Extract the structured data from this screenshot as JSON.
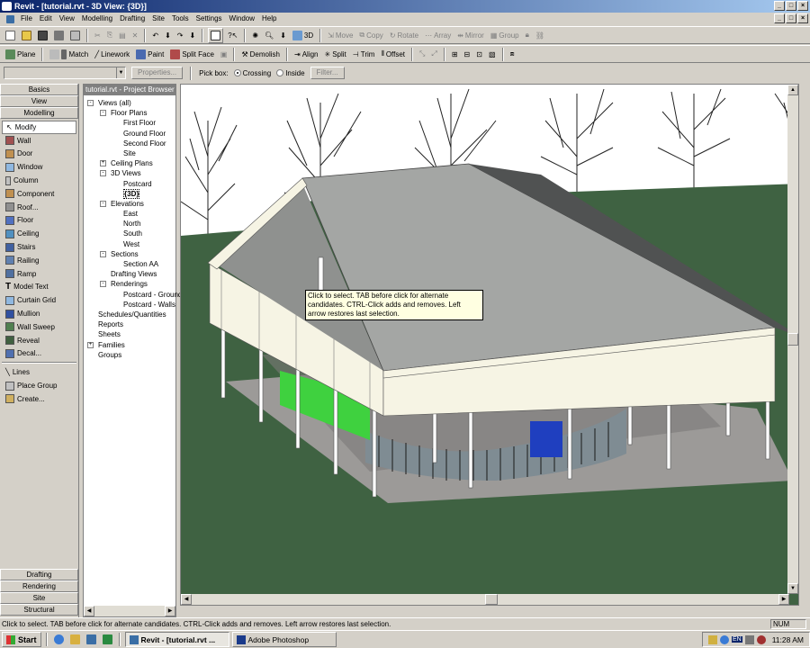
{
  "window": {
    "title": "Revit - [tutorial.rvt - 3D View: {3D}]"
  },
  "menu": [
    "File",
    "Edit",
    "View",
    "Modelling",
    "Drafting",
    "Site",
    "Tools",
    "Settings",
    "Window",
    "Help"
  ],
  "toolbar1": {
    "view3d_label": "3D",
    "edit_tools": [
      "Move",
      "Copy",
      "Rotate",
      "Array",
      "Mirror",
      "Group"
    ]
  },
  "toolbar2": [
    "Plane",
    "Match",
    "Linework",
    "Paint",
    "Split Face",
    "Demolish",
    "Align",
    "Split",
    "Trim",
    "Offset"
  ],
  "typerow": {
    "properties": "Properties...",
    "pickbox": "Pick box:",
    "crossing": "Crossing",
    "inside": "Inside",
    "filter": "Filter..."
  },
  "designbar": {
    "tabs_top": [
      "Basics",
      "View",
      "Modelling"
    ],
    "tools": [
      "Modify",
      "Wall",
      "Door",
      "Window",
      "Column",
      "Component",
      "Roof...",
      "Floor",
      "Ceiling",
      "Stairs",
      "Railing",
      "Ramp",
      "Model Text",
      "Curtain Grid",
      "Mullion",
      "Wall Sweep",
      "Reveal",
      "Decal...",
      "Lines",
      "Place Group",
      "Create..."
    ],
    "tabs_bottom": [
      "Drafting",
      "Rendering",
      "Site",
      "Structural"
    ]
  },
  "browser": {
    "title": "tutorial.rvt - Project Browser",
    "items": [
      {
        "label": "Views (all)",
        "level": 0,
        "toggle": "-"
      },
      {
        "label": "Floor Plans",
        "level": 1,
        "toggle": "-"
      },
      {
        "label": "First Floor",
        "level": 2
      },
      {
        "label": "Ground Floor",
        "level": 2
      },
      {
        "label": "Second Floor",
        "level": 2
      },
      {
        "label": "Site",
        "level": 2
      },
      {
        "label": "Ceiling Plans",
        "level": 1,
        "toggle": "+"
      },
      {
        "label": "3D Views",
        "level": 1,
        "toggle": "-"
      },
      {
        "label": "Postcard",
        "level": 2
      },
      {
        "label": "{3D}",
        "level": 2,
        "selected": true
      },
      {
        "label": "Elevations",
        "level": 1,
        "toggle": "-"
      },
      {
        "label": "East",
        "level": 2
      },
      {
        "label": "North",
        "level": 2
      },
      {
        "label": "South",
        "level": 2
      },
      {
        "label": "West",
        "level": 2
      },
      {
        "label": "Sections",
        "level": 1,
        "toggle": "-"
      },
      {
        "label": "Section AA",
        "level": 2
      },
      {
        "label": "Drafting Views",
        "level": 1
      },
      {
        "label": "Renderings",
        "level": 1,
        "toggle": "-"
      },
      {
        "label": "Postcard - Ground",
        "level": 2
      },
      {
        "label": "Postcard - Walls",
        "level": 2
      },
      {
        "label": "Schedules/Quantities",
        "level": 0
      },
      {
        "label": "Reports",
        "level": 0
      },
      {
        "label": "Sheets",
        "level": 0
      },
      {
        "label": "Families",
        "level": 0,
        "toggle": "+"
      },
      {
        "label": "Groups",
        "level": 0
      }
    ]
  },
  "tooltip": "Click to select. TAB before click for alternate candidates. CTRL-Click adds and removes. Left arrow restores last selection.",
  "status": {
    "text": "Click to select. TAB before click for alternate candidates. CTRL-Click adds and removes. Left arrow restores last selection.",
    "num": "NUM"
  },
  "taskbar": {
    "start": "Start",
    "tasks": [
      "Revit - [tutorial.rvt ...",
      "Adobe Photoshop"
    ],
    "lang": "EN",
    "clock": "11:28 AM"
  },
  "colors": {
    "titlebar": "#0a246a",
    "ground": "#3f6242",
    "roof": "#a4a6a4",
    "wall": "#f6f4e4",
    "glass_blue": "#1f3fbf",
    "green_panel": "#3fd13f"
  }
}
